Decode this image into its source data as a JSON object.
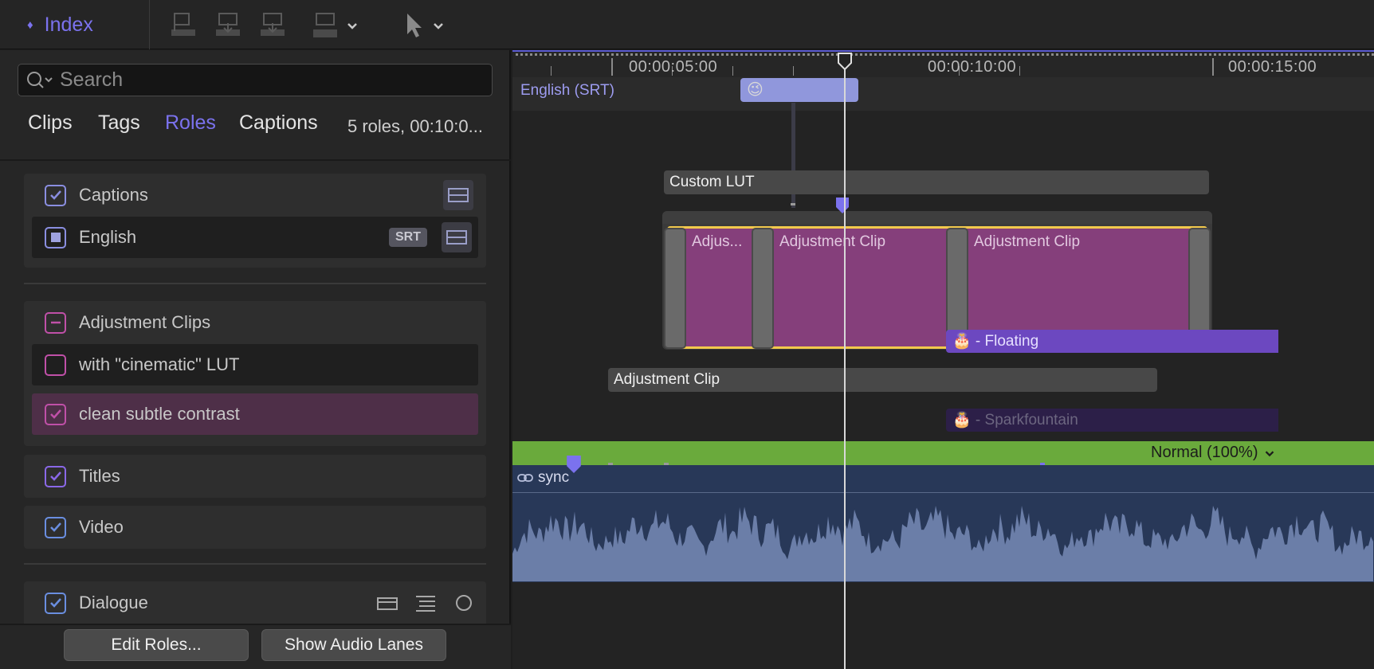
{
  "toolbar": {
    "index_label": "Index",
    "icons": [
      "flag-icon",
      "import-clip-icon",
      "overwrite-clip-icon",
      "append-clip-icon",
      "select-tool-icon"
    ]
  },
  "left_panel": {
    "search_placeholder": "Search",
    "tabs": [
      "Clips",
      "Tags",
      "Roles",
      "Captions"
    ],
    "active_tab": "Roles",
    "summary": "5 roles, 00:10:0...",
    "roles": {
      "captions": {
        "label": "Captions",
        "sub": {
          "label": "English",
          "badge": "SRT"
        }
      },
      "adjustment": {
        "label": "Adjustment Clips",
        "subs": [
          "with \"cinematic\" LUT",
          "clean subtle contrast"
        ]
      },
      "titles": "Titles",
      "video": "Video",
      "dialogue": "Dialogue"
    },
    "footer": {
      "edit_roles": "Edit Roles...",
      "show_audio_lanes": "Show Audio Lanes"
    }
  },
  "timeline": {
    "timecodes": [
      "00:00:05:00",
      "00:00:10:00",
      "00:00:15:00"
    ],
    "caption_lane": "English (SRT)",
    "caption_clip_emoji": "😉",
    "clips": {
      "custom_lut": "Custom LUT",
      "adj_a": "Adjus...",
      "adj_b": "Adjustment Clip",
      "adj_c": "Adjustment Clip",
      "floating": "🎂 - Floating",
      "adjustment_clip": "Adjustment Clip",
      "sparkfountain": "🎂 - Sparkfountain"
    },
    "blend_mode": "Normal (100%)",
    "audio_label": "sync"
  },
  "colors": {
    "accent": "#7b72ee",
    "adjustment": "#853f7b",
    "selection": "#f2c94c",
    "title": "#6c48c0",
    "video": "#6aaa3c",
    "audio": "#283858"
  }
}
